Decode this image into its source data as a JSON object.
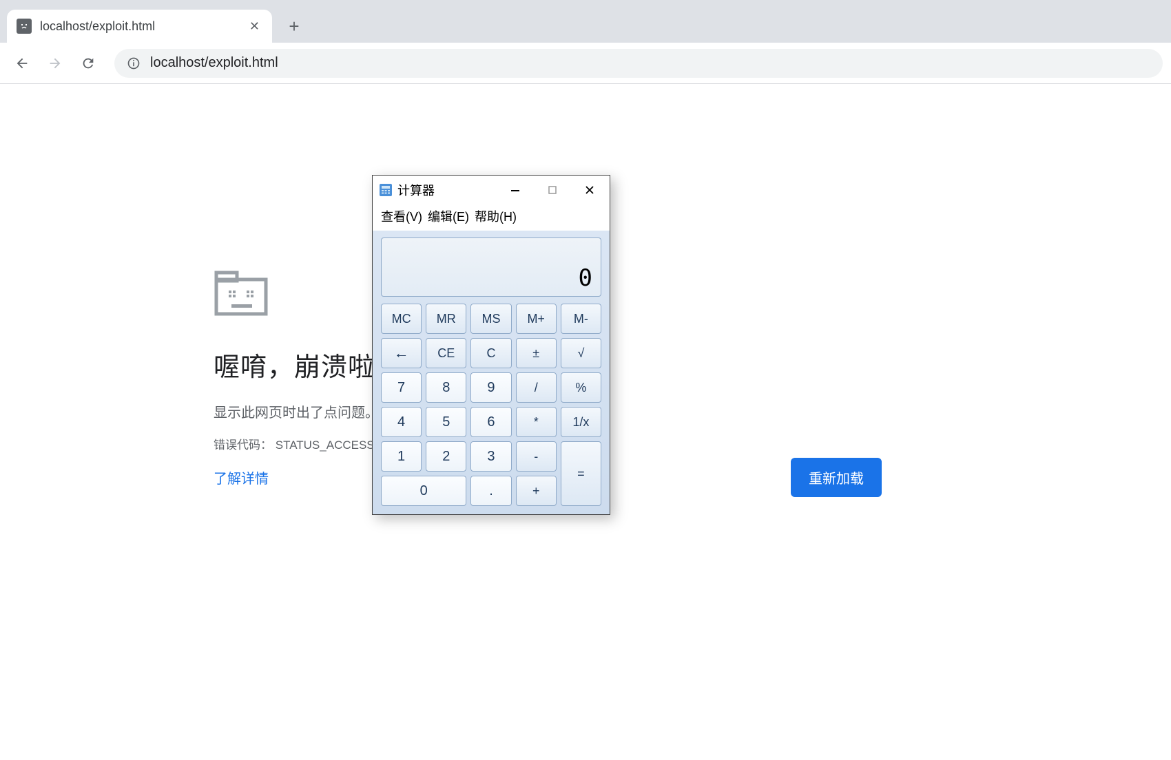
{
  "browser": {
    "tab": {
      "title": "localhost/exploit.html",
      "close": "✕"
    },
    "new_tab": "+",
    "url": "localhost/exploit.html"
  },
  "error": {
    "title": "喔唷，崩溃啦！",
    "subtitle": "显示此网页时出了点问题。",
    "code_label": "错误代码：",
    "code_value": "STATUS_ACCESS_VI",
    "learn_more": "了解详情",
    "reload": "重新加载"
  },
  "calc": {
    "title": "计算器",
    "menu": {
      "view": "查看(V)",
      "edit": "编辑(E)",
      "help": "帮助(H)"
    },
    "display": "0",
    "buttons": {
      "mc": "MC",
      "mr": "MR",
      "ms": "MS",
      "mplus": "M+",
      "mminus": "M-",
      "back": "←",
      "ce": "CE",
      "c": "C",
      "pm": "±",
      "sqrt": "√",
      "b7": "7",
      "b8": "8",
      "b9": "9",
      "div": "/",
      "pct": "%",
      "b4": "4",
      "b5": "5",
      "b6": "6",
      "mul": "*",
      "inv": "1/x",
      "b1": "1",
      "b2": "2",
      "b3": "3",
      "sub": "-",
      "eq": "=",
      "b0": "0",
      "dot": ".",
      "add": "+"
    }
  }
}
